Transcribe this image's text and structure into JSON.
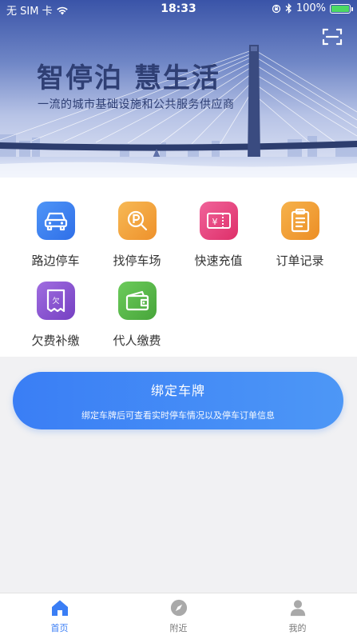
{
  "status_bar": {
    "carrier": "无 SIM 卡",
    "time": "18:33",
    "battery": "100%"
  },
  "banner": {
    "title": "智停泊 慧生活",
    "subtitle": "一流的城市基础设施和公共服务供应商",
    "scan_icon": "scan-icon"
  },
  "menu": {
    "items": [
      {
        "label": "路边停车",
        "icon": "car-icon",
        "color": "#3c82f2"
      },
      {
        "label": "找停车场",
        "icon": "parking-search-icon",
        "color": "#f2a43a"
      },
      {
        "label": "快速充值",
        "icon": "yuan-ticket-icon",
        "color": "#e7477f"
      },
      {
        "label": "订单记录",
        "icon": "clipboard-icon",
        "color": "#f0a032"
      },
      {
        "label": "欠费补缴",
        "icon": "overdue-receipt-icon",
        "color": "#8b57cf"
      },
      {
        "label": "代人缴费",
        "icon": "wallet-icon",
        "color": "#57b94a"
      }
    ]
  },
  "bind_plate": {
    "title": "绑定车牌",
    "description": "绑定车牌后可查看实时停车情况以及停车订单信息"
  },
  "tabbar": {
    "items": [
      {
        "label": "首页",
        "icon": "home-icon",
        "active": true
      },
      {
        "label": "附近",
        "icon": "compass-icon",
        "active": false
      },
      {
        "label": "我的",
        "icon": "user-icon",
        "active": false
      }
    ]
  },
  "colors": {
    "accent": "#3a7ef5",
    "tab_inactive": "#777777"
  }
}
